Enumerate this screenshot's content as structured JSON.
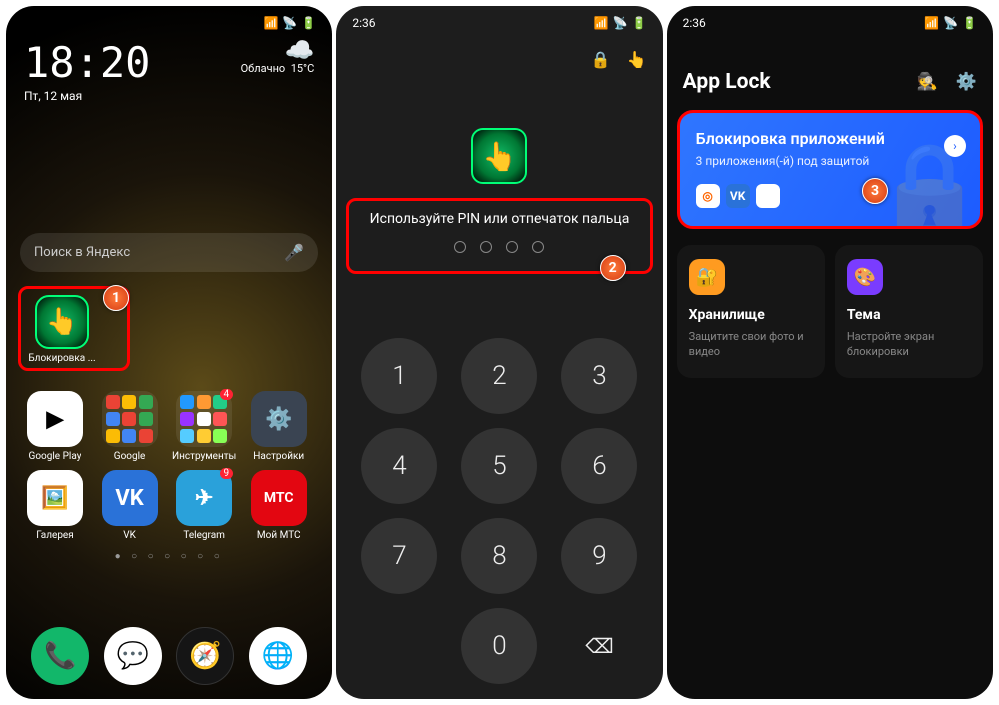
{
  "phone1": {
    "time": "18:20",
    "date": "Пт, 12 мая",
    "weather_desc": "Облачно",
    "weather_temp": "15°C",
    "search_placeholder": "Поиск в Яндекс",
    "locked_app_label": "Блокировка ...",
    "apps": {
      "play": "Google Play",
      "google": "Google",
      "tools": "Инструменты",
      "settings": "Настройки",
      "gallery": "Галерея",
      "vk": "VK",
      "telegram": "Telegram",
      "mts": "Мой МТС"
    },
    "badges": {
      "tools": "4",
      "telegram": "9"
    }
  },
  "phone2": {
    "status_time": "2:36",
    "pin_prompt": "Используйте PIN или отпечаток пальца",
    "keys": [
      "1",
      "2",
      "3",
      "4",
      "5",
      "6",
      "7",
      "8",
      "9",
      "",
      "0",
      "⌫"
    ]
  },
  "phone3": {
    "status_time": "2:36",
    "title": "App Lock",
    "card": {
      "title": "Блокировка приложений",
      "subtitle": "3 приложения(-й) под защитой"
    },
    "storage": {
      "title": "Хранилище",
      "desc": "Защитите свои фото и видео"
    },
    "theme": {
      "title": "Тема",
      "desc": "Настройте экран блокировки"
    }
  },
  "steps": {
    "s1": "1",
    "s2": "2",
    "s3": "3"
  }
}
